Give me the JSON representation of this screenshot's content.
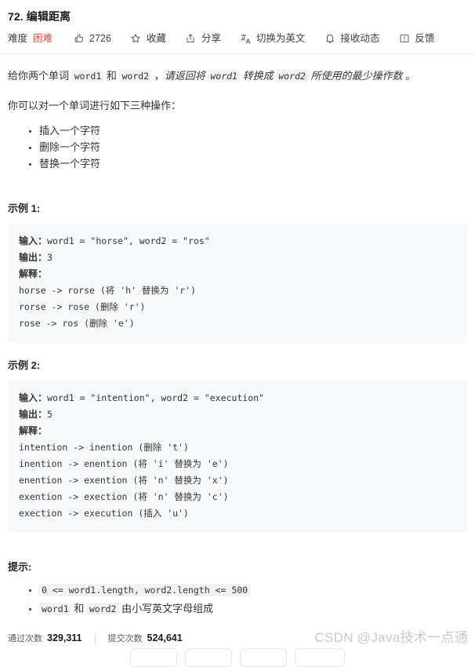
{
  "problem": {
    "title": "72. 编辑距离",
    "difficulty_label": "难度",
    "difficulty_value": "困难",
    "difficulty_color": "#ef4743"
  },
  "toolbar": {
    "likes": "2726",
    "favorite": "收藏",
    "share": "分享",
    "switch_language": "切换为英文",
    "subscribe": "接收动态",
    "feedback": "反馈"
  },
  "description": {
    "line1_a": "给你两个单词 ",
    "line1_code1": "word1",
    "line1_b": " 和 ",
    "line1_code2": "word2",
    "line1_c": " ，",
    "line1_em_a": "请返回将 ",
    "line1_em_code1": "word1",
    "line1_em_b": " 转换成 ",
    "line1_em_code2": "word2",
    "line1_em_c": " 所使用的最少操作数",
    "line1_d": " 。",
    "line2": "你可以对一个单词进行如下三种操作：",
    "operations": [
      "插入一个字符",
      "删除一个字符",
      "替换一个字符"
    ]
  },
  "examples": [
    {
      "heading": "示例 1:",
      "input_label": "输入：",
      "input_value": "word1 = \"horse\", word2 = \"ros\"",
      "output_label": "输出：",
      "output_value": "3",
      "explain_label": "解释：",
      "steps": [
        "horse -> rorse (将 'h' 替换为 'r')",
        "rorse -> rose (删除 'r')",
        "rose -> ros (删除 'e')"
      ]
    },
    {
      "heading": "示例 2:",
      "input_label": "输入：",
      "input_value": "word1 = \"intention\", word2 = \"execution\"",
      "output_label": "输出：",
      "output_value": "5",
      "explain_label": "解释：",
      "steps": [
        "intention -> inention (删除 't')",
        "inention -> enention (将 'i' 替换为 'e')",
        "enention -> exention (将 'n' 替换为 'x')",
        "exention -> exection (将 'n' 替换为 'c')",
        "exection -> execution (插入 'u')"
      ]
    }
  ],
  "hints": {
    "heading": "提示:",
    "item1_code": "0 <= word1.length, word2.length <= 500",
    "item2_code1": "word1",
    "item2_mid": " 和 ",
    "item2_code2": "word2",
    "item2_tail": " 由小写英文字母组成"
  },
  "footer": {
    "accepted_label": "通过次数",
    "accepted_value": "329,311",
    "submissions_label": "提交次数",
    "submissions_value": "524,641"
  },
  "watermark": "CSDN @Java技术一点通"
}
